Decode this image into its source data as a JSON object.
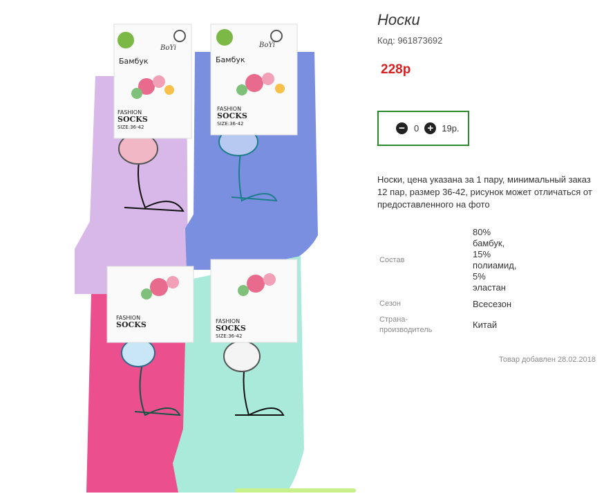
{
  "product": {
    "title": "Носки",
    "code": "Код: 961873692",
    "price": "228р",
    "quantity": "0",
    "unit_price": "19р.",
    "description": "Носки, цена указана за 1 пару, минимальный заказ 12 пар, размер 36-42, рисунок может отличаться от предоставленного на фото",
    "attributes": {
      "composition": {
        "label": "Состав",
        "lines": [
          "80%",
          "бамбук,",
          "15%",
          "полиамид,",
          "5%",
          "эластан"
        ]
      },
      "season": {
        "label": "Сезон",
        "value": "Всесезон"
      },
      "country": {
        "label_lines": [
          "Страна-",
          "производитель"
        ],
        "value": "Китай"
      }
    },
    "added_date": "Товар добавлен 28.02.2018"
  },
  "image": {
    "tag_brand": "Бамбук",
    "tag_logo": "BoYi",
    "tag_fashion": "FASHION",
    "tag_socks": "SOCKS",
    "tag_size": "SIZE:36-42",
    "colors": {
      "lilac": "#d7b8e8",
      "blue": "#7b8fe0",
      "pink": "#ec4f8e",
      "mint": "#a9eadb"
    }
  },
  "icons": {
    "minus": "minus-circle-icon",
    "plus": "plus-circle-icon"
  },
  "colors": {
    "price": "#d82020",
    "qty_border": "#2a8a2a"
  }
}
